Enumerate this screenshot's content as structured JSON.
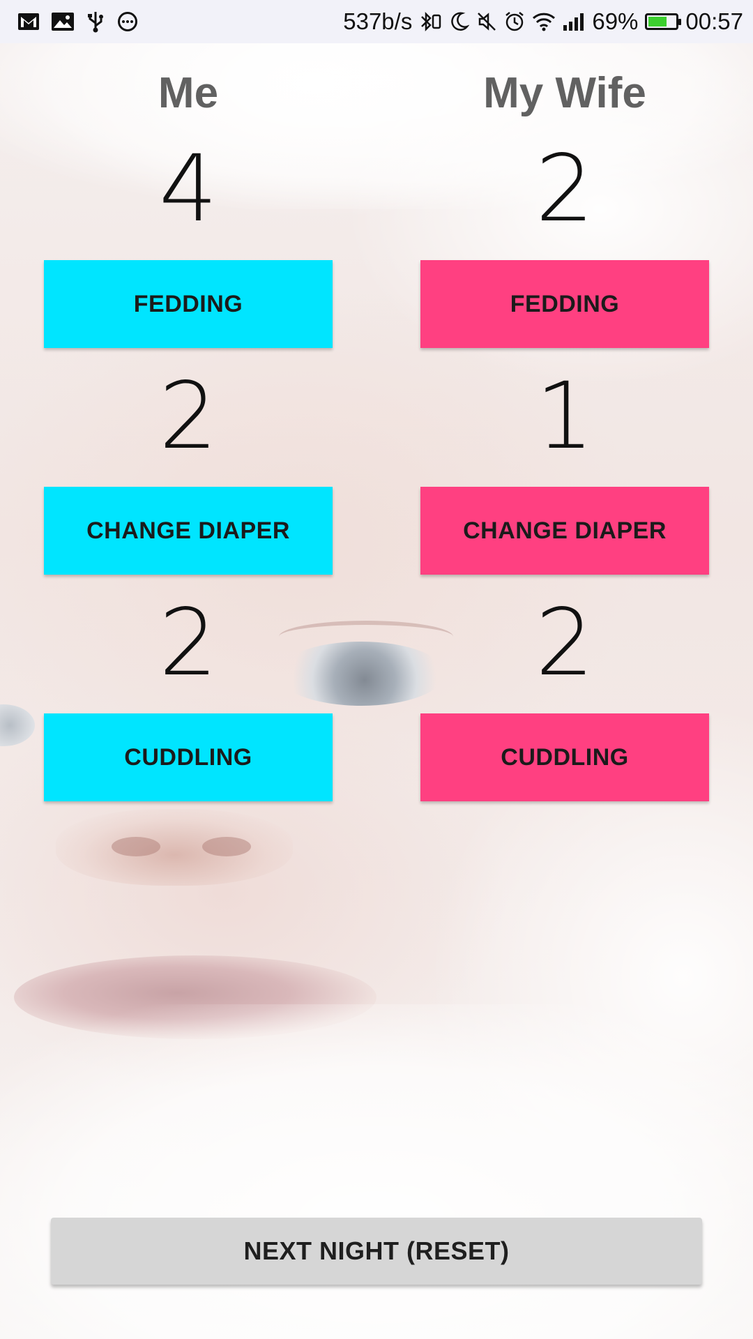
{
  "status_bar": {
    "net_speed": "537b/s",
    "battery_percent": "69%",
    "battery_level": 0.69,
    "time": "00:57",
    "icons_left": [
      "gmail-icon",
      "image-icon",
      "usb-icon",
      "more-circle-icon"
    ],
    "icons_right": [
      "bluetooth-vibrate-icon",
      "moon-icon",
      "mute-icon",
      "alarm-icon",
      "wifi-icon",
      "signal-icon",
      "battery-icon"
    ]
  },
  "columns": {
    "me": {
      "title": "Me",
      "color": "#00e5ff",
      "feeding_count": "4",
      "feeding_label": "FEDDING",
      "diaper_count": "2",
      "diaper_label": "CHANGE DIAPER",
      "cuddling_count": "2",
      "cuddling_label": "CUDDLING"
    },
    "wife": {
      "title": "My Wife",
      "color": "#ff4081",
      "feeding_count": "2",
      "feeding_label": "FEDDING",
      "diaper_count": "1",
      "diaper_label": "CHANGE DIAPER",
      "cuddling_count": "2",
      "cuddling_label": "CUDDLING"
    }
  },
  "reset_label": "NEXT NIGHT (RESET)"
}
